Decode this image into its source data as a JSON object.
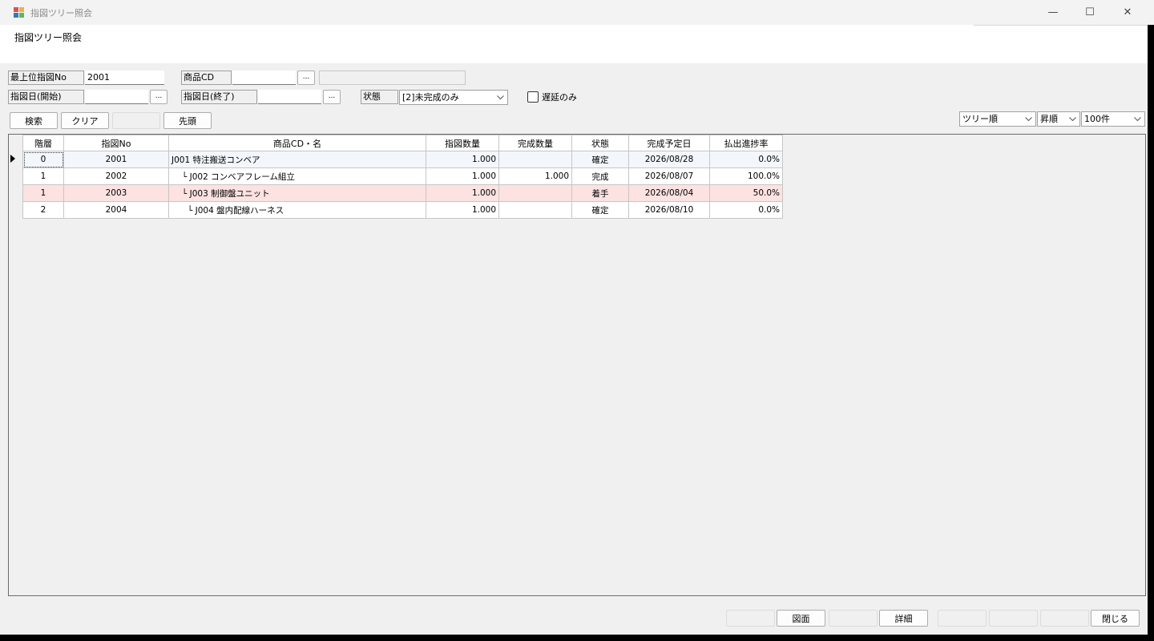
{
  "window": {
    "title": "指図ツリー照会",
    "minimize_glyph": "—",
    "maximize_glyph": "☐",
    "close_glyph": "✕"
  },
  "header": {
    "title": "指図ツリー照会"
  },
  "filters": {
    "top_order_no": {
      "label": "最上位指図No",
      "value": "2001"
    },
    "product_cd": {
      "label": "商品CD",
      "value": "",
      "picker_label": "...",
      "name_value": ""
    },
    "order_date_start": {
      "label": "指図日(開始)",
      "value": "",
      "picker_label": "..."
    },
    "order_date_end": {
      "label": "指図日(終了)",
      "value": "",
      "picker_label": "..."
    },
    "status": {
      "label": "状態",
      "value": "[2]未完成のみ"
    },
    "delay_only": {
      "label": "遅延のみ",
      "checked": false
    }
  },
  "toolbar": {
    "search_label": "検索",
    "clear_label": "クリア",
    "top_label": "先頭",
    "sort_order": "ツリー順",
    "sort_direction": "昇順",
    "page_size": "100件"
  },
  "grid": {
    "columns": [
      "階層",
      "指図No",
      "商品CD・名",
      "指図数量",
      "完成数量",
      "状態",
      "完成予定日",
      "払出進捗率"
    ],
    "rows": [
      {
        "level": "0",
        "order_no": "2001",
        "product": "J001  特注搬送コンベア",
        "order_qty": "1.000",
        "done_qty": "",
        "status": "確定",
        "due_date": "2026/08/28",
        "progress": "0.0%"
      },
      {
        "level": "1",
        "order_no": "2002",
        "product": "└ J002  コンベアフレーム組立",
        "order_qty": "1.000",
        "done_qty": "1.000",
        "status": "完成",
        "due_date": "2026/08/07",
        "progress": "100.0%"
      },
      {
        "level": "1",
        "order_no": "2003",
        "product": "└ J003  制御盤ユニット",
        "order_qty": "1.000",
        "done_qty": "",
        "status": "着手",
        "due_date": "2026/08/04",
        "progress": "50.0%"
      },
      {
        "level": "2",
        "order_no": "2004",
        "product": "└ J004  盤内配線ハーネス",
        "order_qty": "1.000",
        "done_qty": "",
        "status": "確定",
        "due_date": "2026/08/10",
        "progress": "0.0%"
      }
    ]
  },
  "footer": {
    "drawing_label": "図面",
    "detail_label": "詳細",
    "close_label": "閉じる"
  },
  "colors": {
    "alert_row": "#fde2e2",
    "current_row": "#f3f7fb",
    "grid_border": "#c6c6c6"
  }
}
